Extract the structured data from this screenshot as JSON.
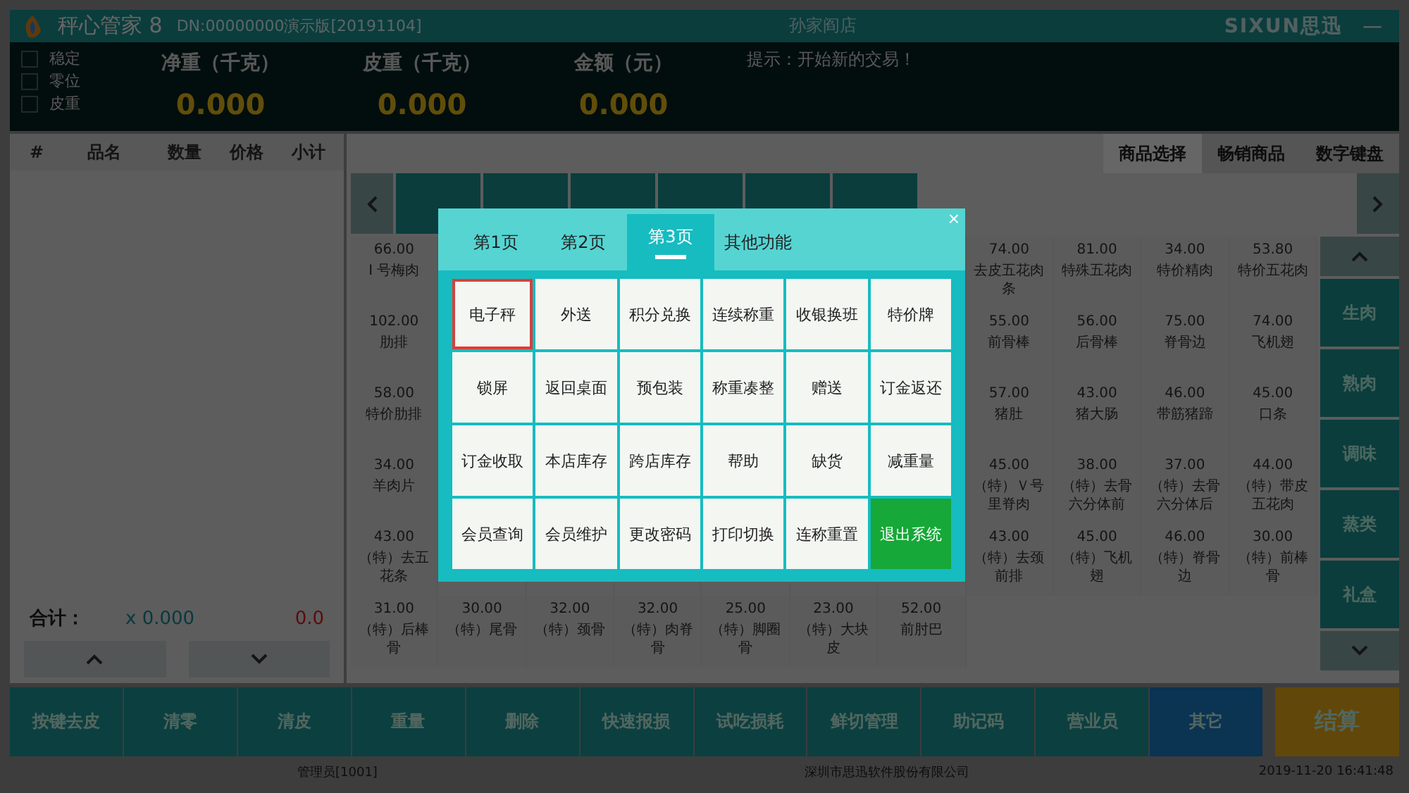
{
  "title_bar": {
    "app_name": "秤心管家 8",
    "license": "DN:00000000演示版[20191104]",
    "store": "孙家阎店",
    "brand": "SIXUN思迅",
    "minimize": "—"
  },
  "scale_panel": {
    "flags": [
      {
        "label": "稳定",
        "checked": false
      },
      {
        "label": "零位",
        "checked": false
      },
      {
        "label": "皮重",
        "checked": false
      }
    ],
    "readings": [
      {
        "label": "净重（千克）",
        "value": "0.000"
      },
      {
        "label": "皮重（千克）",
        "value": "0.000"
      },
      {
        "label": "金额（元）",
        "value": "0.000"
      }
    ],
    "hint": "提示：开始新的交易！"
  },
  "cart": {
    "columns": [
      "#",
      "品名",
      "数量",
      "价格",
      "小计"
    ],
    "total_label": "合计：",
    "total_qty": "x 0.000",
    "total_amount": "0.0"
  },
  "view_tabs": [
    {
      "label": "商品选择",
      "selected": true
    },
    {
      "label": "畅销商品",
      "selected": false
    },
    {
      "label": "数字键盘",
      "selected": false
    }
  ],
  "products": {
    "rows": [
      [
        {
          "price": "66.00",
          "name": "I 号梅肉"
        },
        {},
        {},
        {},
        {},
        {},
        {},
        {
          "price": "74.00",
          "name": "去皮五花肉条"
        },
        {
          "price": "81.00",
          "name": "特殊五花肉"
        },
        {
          "price": "34.00",
          "name": "特价精肉"
        },
        {
          "price": "53.80",
          "name": "特价五花肉"
        }
      ],
      [
        {
          "price": "102.00",
          "name": "肋排"
        },
        {},
        {},
        {},
        {},
        {},
        {},
        {
          "price": "55.00",
          "name": "前骨棒"
        },
        {
          "price": "56.00",
          "name": "后骨棒"
        },
        {
          "price": "75.00",
          "name": "脊骨边"
        },
        {
          "price": "74.00",
          "name": "飞机翅"
        }
      ],
      [
        {
          "price": "58.00",
          "name": "特价肋排"
        },
        {},
        {},
        {},
        {},
        {},
        {},
        {
          "price": "57.00",
          "name": "猪肚"
        },
        {
          "price": "43.00",
          "name": "猪大肠"
        },
        {
          "price": "46.00",
          "name": "带筋猪蹄"
        },
        {
          "price": "45.00",
          "name": "口条"
        }
      ],
      [
        {
          "price": "34.00",
          "name": "羊肉片"
        },
        {},
        {},
        {},
        {},
        {},
        {},
        {
          "price": "45.00",
          "name": "（特）Ｖ号里脊肉"
        },
        {
          "price": "38.00",
          "name": "（特）去骨六分体前"
        },
        {
          "price": "37.00",
          "name": "（特）去骨六分体后"
        },
        {
          "price": "44.00",
          "name": "（特）带皮五花肉"
        }
      ],
      [
        {
          "price": "43.00",
          "name": "（特）去五花条"
        },
        {},
        {},
        {},
        {},
        {},
        {},
        {
          "price": "43.00",
          "name": "（特）去颈前排"
        },
        {
          "price": "45.00",
          "name": "（特）飞机翅"
        },
        {
          "price": "46.00",
          "name": "（特）脊骨边"
        },
        {
          "price": "30.00",
          "name": "（特）前棒骨"
        }
      ],
      [
        {
          "price": "31.00",
          "name": "（特）后棒骨"
        },
        {
          "price": "30.00",
          "name": "（特）尾骨"
        },
        {
          "price": "32.00",
          "name": "（特）颈骨"
        },
        {
          "price": "32.00",
          "name": "（特）肉脊骨"
        },
        {
          "price": "25.00",
          "name": "（特）脚圈骨"
        },
        {
          "price": "23.00",
          "name": "（特）大块皮"
        },
        {
          "price": "52.00",
          "name": "前肘巴"
        }
      ]
    ]
  },
  "categories": [
    "生肉",
    "熟肉",
    "调味",
    "蒸类",
    "礼盒"
  ],
  "actions": [
    {
      "label": "按键去皮",
      "kind": "normal"
    },
    {
      "label": "清零",
      "kind": "normal"
    },
    {
      "label": "清皮",
      "kind": "normal"
    },
    {
      "label": "重量",
      "kind": "normal"
    },
    {
      "label": "删除",
      "kind": "normal"
    },
    {
      "label": "快速报损",
      "kind": "normal"
    },
    {
      "label": "试吃损耗",
      "kind": "normal"
    },
    {
      "label": "鲜切管理",
      "kind": "normal"
    },
    {
      "label": "助记码",
      "kind": "normal"
    },
    {
      "label": "营业员",
      "kind": "normal"
    },
    {
      "label": "其它",
      "kind": "other"
    },
    {
      "label": "结算",
      "kind": "checkout"
    }
  ],
  "status_bar": {
    "operator": "管理员[1001]",
    "company": "深圳市思迅软件股份有限公司",
    "datetime": "2019-11-20 16:41:48"
  },
  "dialog": {
    "close": "×",
    "tabs": [
      {
        "label": "第1页",
        "selected": false
      },
      {
        "label": "第2页",
        "selected": false
      },
      {
        "label": "第3页",
        "selected": true
      },
      {
        "label": "其他功能",
        "selected": false
      }
    ],
    "buttons": [
      {
        "label": "电子秤",
        "kind": "normal",
        "selected": true
      },
      {
        "label": "外送",
        "kind": "normal",
        "selected": false
      },
      {
        "label": "积分兑换",
        "kind": "normal",
        "selected": false
      },
      {
        "label": "连续称重",
        "kind": "normal",
        "selected": false
      },
      {
        "label": "收银换班",
        "kind": "normal",
        "selected": false
      },
      {
        "label": "特价牌",
        "kind": "normal",
        "selected": false
      },
      {
        "label": "锁屏",
        "kind": "normal",
        "selected": false
      },
      {
        "label": "返回桌面",
        "kind": "normal",
        "selected": false
      },
      {
        "label": "预包装",
        "kind": "normal",
        "selected": false
      },
      {
        "label": "称重凑整",
        "kind": "normal",
        "selected": false
      },
      {
        "label": "赠送",
        "kind": "normal",
        "selected": false
      },
      {
        "label": "订金返还",
        "kind": "normal",
        "selected": false
      },
      {
        "label": "订金收取",
        "kind": "normal",
        "selected": false
      },
      {
        "label": "本店库存",
        "kind": "normal",
        "selected": false
      },
      {
        "label": "跨店库存",
        "kind": "normal",
        "selected": false
      },
      {
        "label": "帮助",
        "kind": "normal",
        "selected": false
      },
      {
        "label": "缺货",
        "kind": "normal",
        "selected": false
      },
      {
        "label": "减重量",
        "kind": "normal",
        "selected": false
      },
      {
        "label": "会员查询",
        "kind": "normal",
        "selected": false
      },
      {
        "label": "会员维护",
        "kind": "normal",
        "selected": false
      },
      {
        "label": "更改密码",
        "kind": "normal",
        "selected": false
      },
      {
        "label": "打印切换",
        "kind": "normal",
        "selected": false
      },
      {
        "label": "连称重置",
        "kind": "normal",
        "selected": false
      },
      {
        "label": "退出系统",
        "kind": "exit",
        "selected": false
      }
    ]
  }
}
